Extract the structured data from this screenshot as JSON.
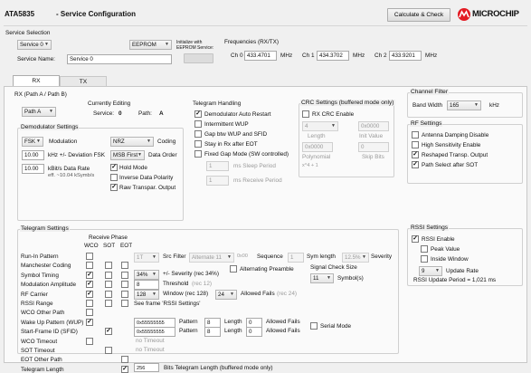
{
  "header": {
    "chip": "ATA5835",
    "title": "- Service Configuration",
    "calc_button": "Calculate & Check",
    "logo_text": "MICROCHIP",
    "logo_color": "#e31b23"
  },
  "service_selection": {
    "title": "Service Selection",
    "service_select": "Service 0",
    "eeprom_select": "EEPROM",
    "init_label": "Initialize with EEPROM Service:",
    "service_name_label": "Service Name:",
    "service_name_value": "Service 0"
  },
  "frequencies": {
    "title": "Frequencies (RX/TX)",
    "ch0_label": "Ch 0",
    "ch0_value": "433.4701",
    "ch1_label": "Ch 1",
    "ch1_value": "434.3702",
    "ch2_label": "Ch 2",
    "ch2_value": "433.9201",
    "unit": "MHz"
  },
  "tabs": [
    {
      "label": "RX",
      "active": true
    },
    {
      "label": "TX",
      "active": false
    }
  ],
  "rx": {
    "path_title": "RX (Path A / Path B)",
    "path_select": "Path A",
    "currently_editing": {
      "title": "Currently Editing",
      "service_label": "Service:",
      "service_value": "0",
      "path_label": "Path:",
      "path_value": "A"
    },
    "demod": {
      "title": "Demodulator Settings",
      "mod_select": "FSK",
      "mod_label": "Modulation",
      "coding_select": "NRZ",
      "coding_label": "Coding",
      "dev_value": "10.00",
      "dev_label": "kHz +/- Deviation FSK",
      "order_select": "MSB First",
      "order_label": "Data Order",
      "rate_value": "10.00",
      "rate_label": "kBit/s Data Rate",
      "rate_eff": "eff. ~10.04 kSymb/s",
      "hold_label": "Hold Mode",
      "inverse_label": "Inverse Data Polarity",
      "raw_label": "Raw Transpar. Output"
    },
    "telegram_handling": {
      "title": "Telegram Handling",
      "items": [
        {
          "label": "Demodulator Auto Restart",
          "checked": true
        },
        {
          "label": "Intermittent WUP",
          "checked": false
        },
        {
          "label": "Gap btw WUP and SFID",
          "checked": false
        },
        {
          "label": "Stay in Rx after EOT",
          "checked": false
        },
        {
          "label": "Fixed Gap Mode (SW controlled)",
          "checked": false
        }
      ],
      "sleep_value": "1",
      "sleep_label": "ms  Sleep Period",
      "receive_value": "1",
      "receive_label": "ms  Receive Period"
    },
    "crc": {
      "title": "CRC Settings (buffered mode only)",
      "enable_label": "RX CRC Enable",
      "length_select": "4",
      "length_label": "Length",
      "init_value": "0x0000",
      "init_label": "Init Value",
      "poly_value": "0x0000",
      "poly_label": "Polynomial",
      "skip_value": "0",
      "skip_label": "Skip Bits",
      "formula": "x^4 + 1"
    }
  },
  "channel_filter": {
    "title": "Channel Filter",
    "bw_label": "Band Width",
    "bw_select": "165",
    "bw_unit": "kHz"
  },
  "rf_settings": {
    "title": "RF Settings",
    "items": [
      {
        "label": "Antenna Damping Disable",
        "checked": false
      },
      {
        "label": "High Sensitivity Enable",
        "checked": false
      },
      {
        "label": "Reshaped Transp. Output",
        "checked": true
      },
      {
        "label": "Path Select after SOT",
        "checked": true
      }
    ]
  },
  "rssi": {
    "title": "RSSI Settings",
    "enable_label": "RSSI Enable",
    "peak_label": "Peak Value",
    "window_label": "Inside Window",
    "rate_select": "9",
    "rate_label": "Update Rate",
    "period_text": "RSSI Update Period = 1,021 ms"
  },
  "telegram": {
    "title": "Telegram Settings",
    "receive_phase": "Receive Phase",
    "cols": [
      "WCO",
      "SOT",
      "EOT"
    ],
    "rows": [
      {
        "label": "Run-In Pattern",
        "wco": false,
        "sot": null,
        "eot": null
      },
      {
        "label": "Manchester Coding",
        "wco": false,
        "sot": false,
        "eot": false
      },
      {
        "label": "Symbol Timing",
        "wco": true,
        "sot": false,
        "eot": false
      },
      {
        "label": "Modulation Amplitude",
        "wco": true,
        "sot": false,
        "eot": false
      },
      {
        "label": "RF Carrier",
        "wco": true,
        "sot": false,
        "eot": false
      },
      {
        "label": "RSSI Range",
        "wco": false,
        "sot": false,
        "eot": false
      },
      {
        "label": "WCO Other Path",
        "wco": false,
        "sot": null,
        "eot": null
      },
      {
        "label": "Wake Up Pattern (WUP)",
        "wco": true,
        "sot": null,
        "eot": null
      },
      {
        "label": "Start-Frame ID (SFID)",
        "wco": null,
        "sot": true,
        "eot": null
      },
      {
        "label": "WCO Timeout",
        "wco": false,
        "sot": null,
        "eot": null
      },
      {
        "label": "SOT Timeout",
        "wco": null,
        "sot": false,
        "eot": null
      },
      {
        "label": "EOT Other Path",
        "wco": null,
        "sot": null,
        "eot": false
      },
      {
        "label": "Telegram Length",
        "wco": null,
        "sot": null,
        "eot": true
      }
    ],
    "src_filter_select": "1T",
    "src_filter_label": "Src Filter",
    "sequence_select": "Alternate 11",
    "sequence_num": "0x00",
    "sequence_label": "Sequence",
    "sym_len_value": "1",
    "sym_len_label": "Sym length",
    "severity_select": "12.5%",
    "severity_label": "Severity",
    "alt_preamble_label": "Alternating Preamble",
    "sig_check_title": "Signal Check Size",
    "sig_check_select": "11",
    "sig_check_label": "Symbol(s)",
    "sev34_select": "34%",
    "sev34_label": "+/- Severity (rec 34%)",
    "threshold_value": "8",
    "threshold_label": "Threshold",
    "threshold_rec": "(rec 12)",
    "window_select": "128",
    "window_label": "Window (rec 128)",
    "allowed_select": "24",
    "allowed_label": "Allowed Fails",
    "allowed_rec": "(rec 24)",
    "rssi_frame_label": "See frame 'RSSI Settings'",
    "wup_pattern": "0x55555555",
    "sfid_pattern": "0x55555555",
    "pattern_label": "Pattern",
    "wup_len": "8",
    "sfid_len": "8",
    "length_label": "Length",
    "wup_fails": "0",
    "sfid_fails": "0",
    "fails_label": "Allowed Fails",
    "serial_label": "Serial Mode",
    "no_timeout_1": "no Timeout",
    "no_timeout_2": "no Timeout",
    "tl_value": "256",
    "tl_label": "Bits Telegram Length (buffered mode only)"
  }
}
